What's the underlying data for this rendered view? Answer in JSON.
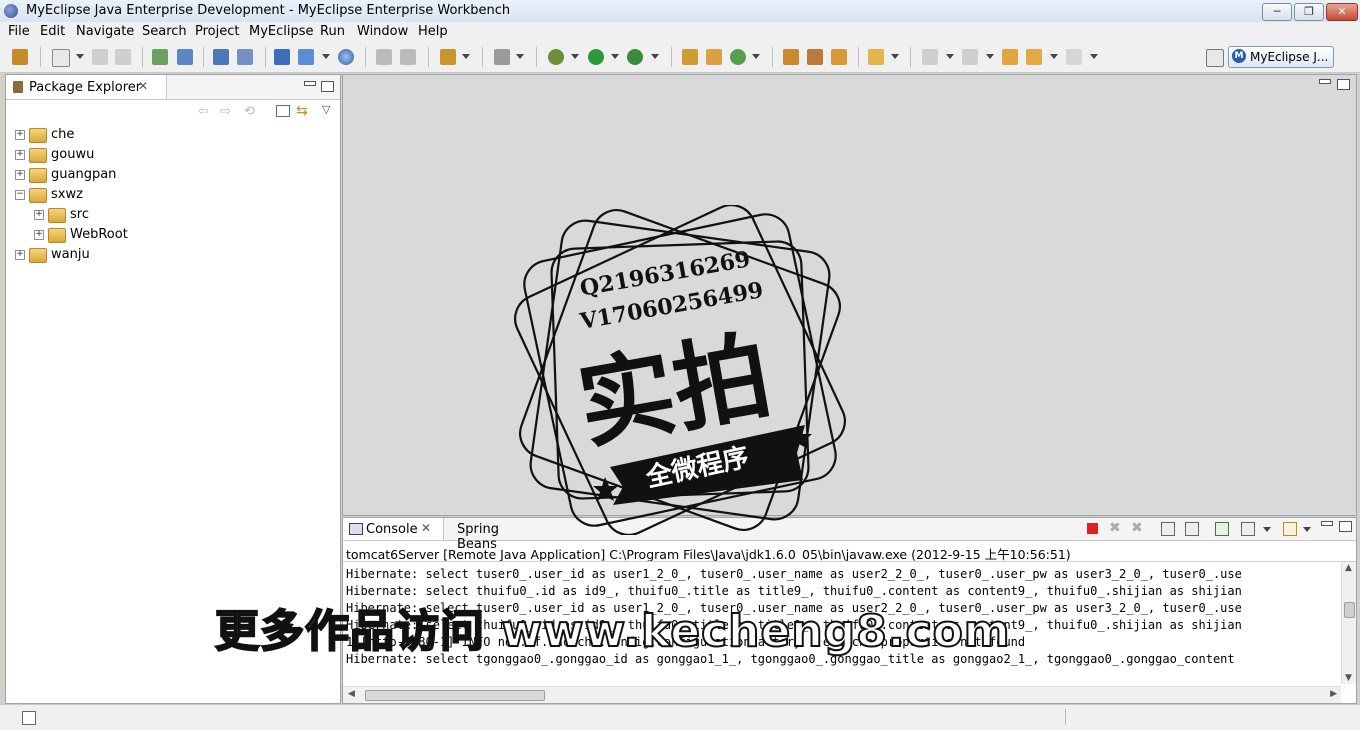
{
  "window": {
    "title": "MyEclipse Java Enterprise Development - MyEclipse Enterprise Workbench",
    "minimize": "─",
    "maximize": "❐",
    "close": "✕"
  },
  "menu": [
    "File",
    "Edit",
    "Navigate",
    "Search",
    "Project",
    "MyEclipse",
    "Run",
    "Window",
    "Help"
  ],
  "perspective": {
    "label": "MyEclipse J..."
  },
  "package_explorer": {
    "title": "Package Explorer",
    "tree": [
      {
        "label": "che",
        "expander": "+"
      },
      {
        "label": "gouwu",
        "expander": "+"
      },
      {
        "label": "guangpan",
        "expander": "+"
      },
      {
        "label": "sxwz",
        "expander": "−"
      },
      {
        "label": "src",
        "expander": "+"
      },
      {
        "label": "WebRoot",
        "expander": "+"
      },
      {
        "label": "wanju",
        "expander": "+"
      }
    ]
  },
  "console": {
    "tab_console": "Console",
    "tab_spring": "Spring Beans",
    "description": "tomcat6Server [Remote Java Application] C:\\Program Files\\Java\\jdk1.6.0_05\\bin\\javaw.exe (2012-9-15 上午10:56:51)",
    "lines": [
      "Hibernate: select tuser0_.user_id as user1_2_0_, tuser0_.user_name as user2_2_0_, tuser0_.user_pw as user3_2_0_, tuser0_.use",
      "Hibernate: select thuifu0_.id as id9_, thuifu0_.title as title9_, thuifu0_.content as content9_, thuifu0_.shijian as shijian",
      "Hibernate: select tuser0_.user_id as user1_2_0_, tuser0_.user_name as user2_2_0_, tuser0_.user_pw as user3_2_0_, tuser0_.use",
      "Hibernate: select thuifu0_.id as id9_, thuifu0_.title as title9_, thuifu0_.content as content9_, thuifu0_.shijian as shijian",
      "1 [http-8080-1] INFO net.sf.ehcache.config.ConfigurationFactory - ehcache.properties not found",
      "Hibernate: select tgonggao0_.gonggao_id as gonggao1_1_, tgonggao0_.gonggao_title as gonggao2_1_, tgonggao0_.gonggao_content"
    ]
  },
  "stamp": {
    "qq": "Q2196316269",
    "wx": "V17060256499",
    "main": "实拍",
    "banner": "全微程序"
  },
  "watermark": "更多作品访问 www.kecheng8.com",
  "colors": {
    "title_bg": "#dde8f5",
    "panel_border": "#9aa5b1",
    "close_btn": "#c44a33",
    "stop_red": "#d22"
  }
}
